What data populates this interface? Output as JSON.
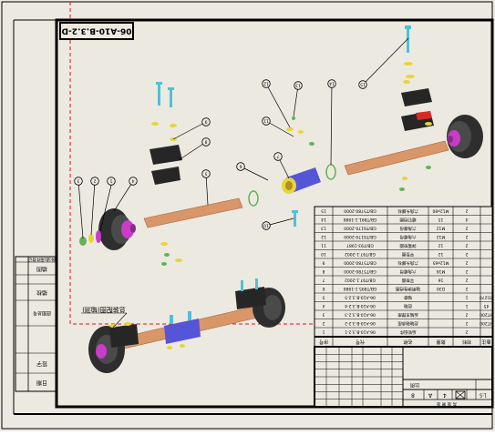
{
  "drawing": {
    "code": "06-A10-B.3.2-D",
    "assembly_label": "总装配图(轴测)"
  },
  "balloons": [
    "1",
    "2",
    "3",
    "4",
    "5",
    "6",
    "7",
    "8",
    "9",
    "10",
    "11",
    "12",
    "13",
    "14",
    "15"
  ],
  "bom": {
    "header": [
      "序号",
      "代号",
      "名称",
      "数量",
      "材料",
      "备注"
    ],
    "rows": [
      [
        "15",
        "GB/T5780-2000",
        "六角头螺栓",
        "M12x80",
        "2",
        ""
      ],
      [
        "14",
        "GB/T891.1-1986",
        "螺钉挡圈",
        "15",
        "4",
        ""
      ],
      [
        "13",
        "GB/T6170-2000",
        "六角螺母",
        "M12",
        "2",
        ""
      ],
      [
        "12",
        "GB/T6170-2000",
        "六角螺母",
        "M12",
        "2",
        ""
      ],
      [
        "11",
        "GB/T93-1987",
        "弹簧垫圈",
        "12",
        "2",
        ""
      ],
      [
        "10",
        "GB/T97.1-2002",
        "平垫圈",
        "12",
        "2",
        ""
      ],
      [
        "9",
        "GB/T5780-2000",
        "六角头螺栓",
        "M12x65",
        "2",
        ""
      ],
      [
        "8",
        "GB/T5780-2000",
        "六角螺母",
        "M16",
        "2",
        ""
      ],
      [
        "7",
        "GB/T97.1-2002",
        "平垫圈",
        "16",
        "2",
        ""
      ],
      [
        "6",
        "GB/T895.1-1986",
        "轴用弹性挡圈",
        "D30",
        "2",
        ""
      ],
      [
        "5",
        "06-A10-B.3.2-5",
        "轴套",
        "",
        "1",
        "ZG270"
      ],
      [
        "4",
        "06-A10-B.3.2-4",
        "后轴",
        "",
        "1",
        "45"
      ],
      [
        "3",
        "06-A10-B.3.2-3",
        "后轴支撑座",
        "",
        "2",
        "HT200"
      ],
      [
        "2",
        "06-A10-B.3.2-2",
        "后轴轴承座",
        "",
        "2",
        "HT200"
      ],
      [
        "1",
        "06-A10-B.3.2-1",
        "后轮组件",
        "",
        "2",
        ""
      ]
    ]
  },
  "title_block": {
    "scale_label": "比例",
    "scale_value": "1:5",
    "sheet_marks": [
      "A",
      "4",
      "8"
    ],
    "sheet_label": "共 张 第 张"
  },
  "side_table": {
    "rows": [
      "借(通)用件登记",
      "描图",
      "描校",
      "底图总号",
      "签字",
      "日期"
    ]
  },
  "colors": {
    "background": "#ece9e1",
    "line": "#000000",
    "red_dash": "#e1141e",
    "wood": "#d99668",
    "tire": "#2e2e2e",
    "hub_magenta": "#c83cc8",
    "support_black": "#262626",
    "cyan_bolt": "#4ec1d6",
    "yellow_washer": "#e8d43a",
    "green_ring": "#63b356"
  }
}
